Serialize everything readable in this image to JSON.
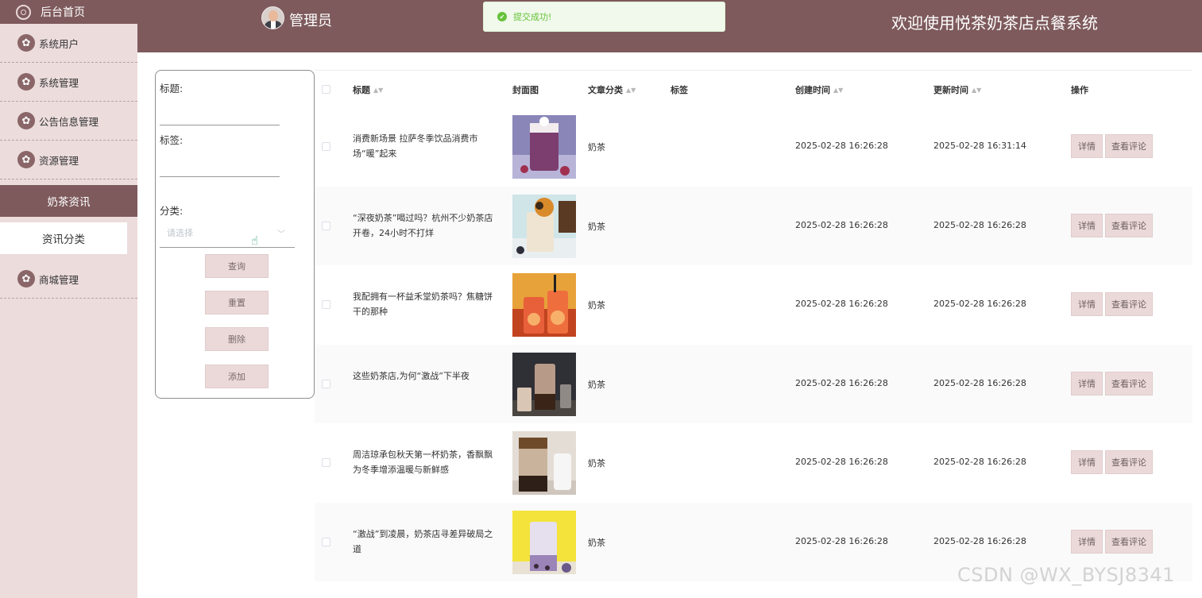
{
  "sidebar": {
    "home": "后台首页",
    "items": [
      {
        "label": "系统用户",
        "icon": "flower-icon"
      },
      {
        "label": "系统管理",
        "icon": "flower-icon"
      },
      {
        "label": "公告信息管理",
        "icon": "flower-icon"
      },
      {
        "label": "资源管理",
        "icon": "flower-icon"
      }
    ],
    "active_item": "奶茶资讯",
    "sub_item": "资讯分类",
    "mall": "商城管理"
  },
  "header": {
    "user": "管理员",
    "welcome": "欢迎使用悦茶奶茶店点餐系统"
  },
  "toast": {
    "message": "提交成功!"
  },
  "search": {
    "title_label": "标题:",
    "tag_label": "标签:",
    "category_label": "分类:",
    "category_placeholder": "请选择",
    "query": "查询",
    "reset": "重置",
    "delete": "删除",
    "add": "添加"
  },
  "table": {
    "columns": [
      "标题",
      "封面图",
      "文章分类",
      "标签",
      "创建时间",
      "更新时间",
      "操作"
    ],
    "rows": [
      {
        "title": "消费新场景 拉萨冬季饮品消费市场“暖”起来",
        "category": "奶茶",
        "created": "2025-02-28 16:26:28",
        "updated": "2025-02-28 16:31:14"
      },
      {
        "title": "“深夜奶茶”喝过吗？杭州不少奶茶店开卷，24小时不打烊",
        "category": "奶茶",
        "created": "2025-02-28 16:26:28",
        "updated": "2025-02-28 16:26:28"
      },
      {
        "title": "我配拥有一杯益禾堂奶茶吗？焦糖饼干的那种",
        "category": "奶茶",
        "created": "2025-02-28 16:26:28",
        "updated": "2025-02-28 16:26:28"
      },
      {
        "title": "这些奶茶店,为何“激战”下半夜",
        "category": "奶茶",
        "created": "2025-02-28 16:26:28",
        "updated": "2025-02-28 16:26:28"
      },
      {
        "title": "周洁琼承包秋天第一杯奶茶，香飘飘为冬季增添温暖与新鲜感",
        "category": "奶茶",
        "created": "2025-02-28 16:26:28",
        "updated": "2025-02-28 16:26:28"
      },
      {
        "title": "“激战”到凌晨，奶茶店寻差异破局之道",
        "category": "奶茶",
        "created": "2025-02-28 16:26:28",
        "updated": "2025-02-28 16:26:28"
      }
    ],
    "detail_label": "详情",
    "comment_label": "查看评论"
  },
  "watermark": "CSDN @WX_BYSJ8341",
  "colors": {
    "brand": "#7e5a5c",
    "sidebar_bg": "#ecdcdc",
    "button_bg": "#ebd9d9",
    "success": "#67c23a"
  }
}
